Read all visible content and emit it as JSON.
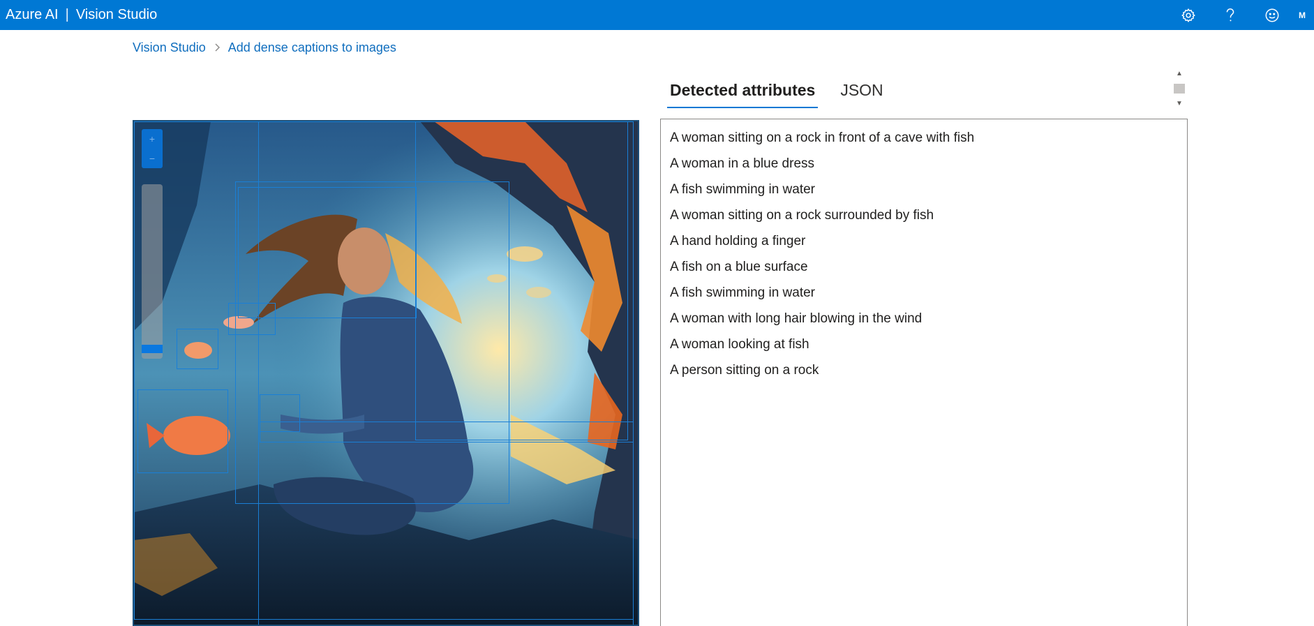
{
  "app": {
    "brand": "Azure AI",
    "separator": "|",
    "product": "Vision Studio",
    "user_initial": "M",
    "icons": [
      "gear-icon",
      "help-icon",
      "smiley-icon"
    ]
  },
  "breadcrumb": {
    "root": "Vision Studio",
    "current": "Add dense captions to images"
  },
  "tabs": [
    {
      "label": "Detected attributes",
      "active": true
    },
    {
      "label": "JSON",
      "active": false
    }
  ],
  "zoom": {
    "in_label": "+",
    "out_label": "−",
    "level": 0.05
  },
  "captions": [
    "A woman sitting on a rock in front of a cave with fish",
    "A woman in a blue dress",
    "A fish swimming in water",
    "A woman sitting on a rock surrounded by fish",
    "A hand holding a finger",
    "A fish on a blue surface",
    "A fish swimming in water",
    "A woman with long hair blowing in the wind",
    "A woman looking at fish",
    "A person sitting on a rock"
  ],
  "colors": {
    "topbar": "#0078d4",
    "link": "#106ebe",
    "bbox": "#1a7fd6"
  }
}
